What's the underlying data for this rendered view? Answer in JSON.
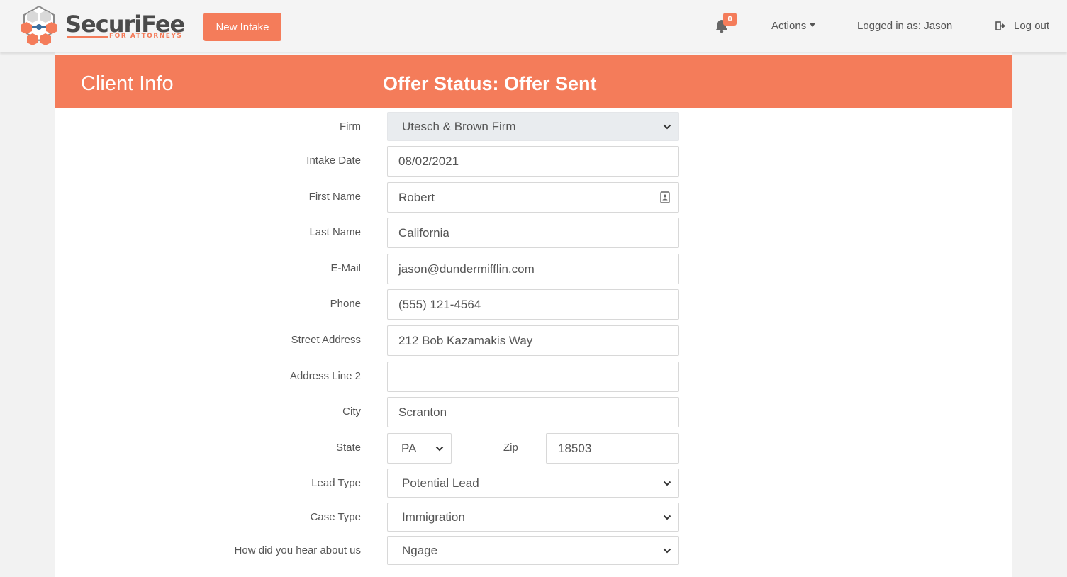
{
  "app": {
    "brand_name": "SecuriFee",
    "brand_tagline": "FOR ATTORNEYS",
    "accent_color": "#f47c5a"
  },
  "nav": {
    "new_intake_label": "New Intake",
    "notification_count": "0",
    "actions_label": "Actions",
    "logged_in_label": "Logged in as: Jason",
    "logout_label": "Log out"
  },
  "header": {
    "title": "Client Info",
    "status": "Offer Status: Offer Sent"
  },
  "form": {
    "firm": {
      "label": "Firm",
      "value": "Utesch & Brown Firm"
    },
    "intake_date": {
      "label": "Intake Date",
      "value": "08/02/2021"
    },
    "first_name": {
      "label": "First Name",
      "value": "Robert"
    },
    "last_name": {
      "label": "Last Name",
      "value": "California"
    },
    "email": {
      "label": "E-Mail",
      "value": "jason@dundermifflin.com"
    },
    "phone": {
      "label": "Phone",
      "value": "(555) 121-4564"
    },
    "street": {
      "label": "Street Address",
      "value": "212 Bob Kazamakis Way"
    },
    "address2": {
      "label": "Address Line 2",
      "value": ""
    },
    "city": {
      "label": "City",
      "value": "Scranton"
    },
    "state": {
      "label": "State",
      "value": "PA"
    },
    "zip": {
      "label": "Zip",
      "value": "18503"
    },
    "lead_type": {
      "label": "Lead Type",
      "value": "Potential Lead"
    },
    "case_type": {
      "label": "Case Type",
      "value": "Immigration"
    },
    "referral": {
      "label": "How did you hear about us",
      "value": "Ngage"
    }
  }
}
